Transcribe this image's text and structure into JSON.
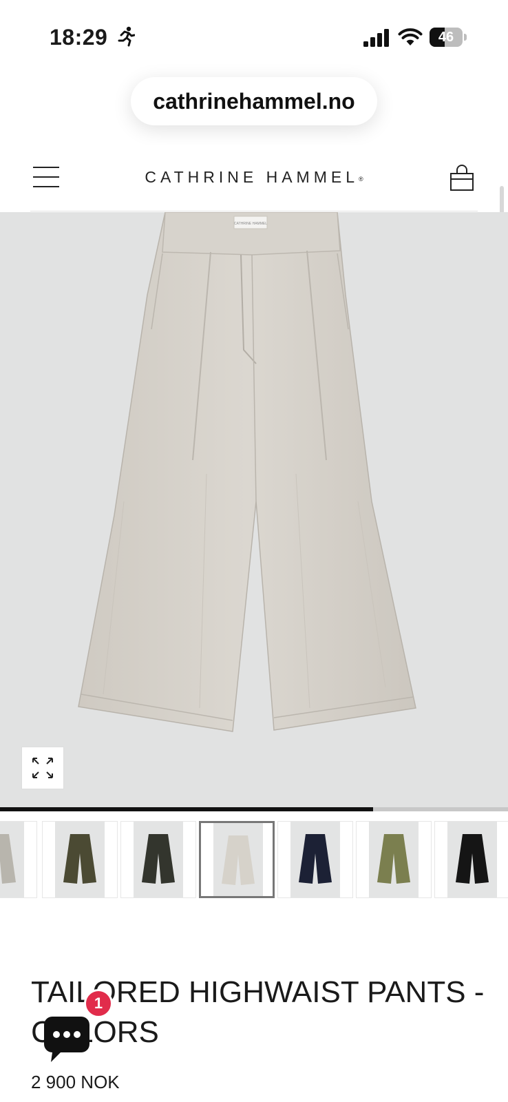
{
  "status_bar": {
    "time": "18:29",
    "battery_percent": "46",
    "battery_level": 0.46,
    "icons": [
      "running-icon",
      "signal-icon",
      "wifi-icon",
      "battery-icon"
    ]
  },
  "browser": {
    "url": "cathrinehammel.no"
  },
  "header": {
    "logo_text": "CATHRINE HAMMEL",
    "logo_mark": "®",
    "icons": [
      "menu-icon",
      "shopping-bag-icon"
    ]
  },
  "gallery": {
    "progress": 0.735,
    "expand_icon": "expand-icon",
    "thumbnails": [
      {
        "color": "#b8b5ad",
        "active": false
      },
      {
        "color": "#4b4a33",
        "active": false
      },
      {
        "color": "#33352d",
        "active": false
      },
      {
        "color": "#d6d2ca",
        "active": true
      },
      {
        "color": "#1c2135",
        "active": false
      },
      {
        "color": "#7b7f4f",
        "active": false
      },
      {
        "color": "#151515",
        "active": false
      }
    ],
    "main_color": "#d5d1ca",
    "waist_label": "CATHRINE HAMMEL"
  },
  "product": {
    "title": "TAILORED HIGHWAIST PANTS - COLORS",
    "price": "2 900 NOK"
  },
  "chat": {
    "badge_count": "1",
    "icon": "chat-icon",
    "accent": "#e12c4b"
  }
}
